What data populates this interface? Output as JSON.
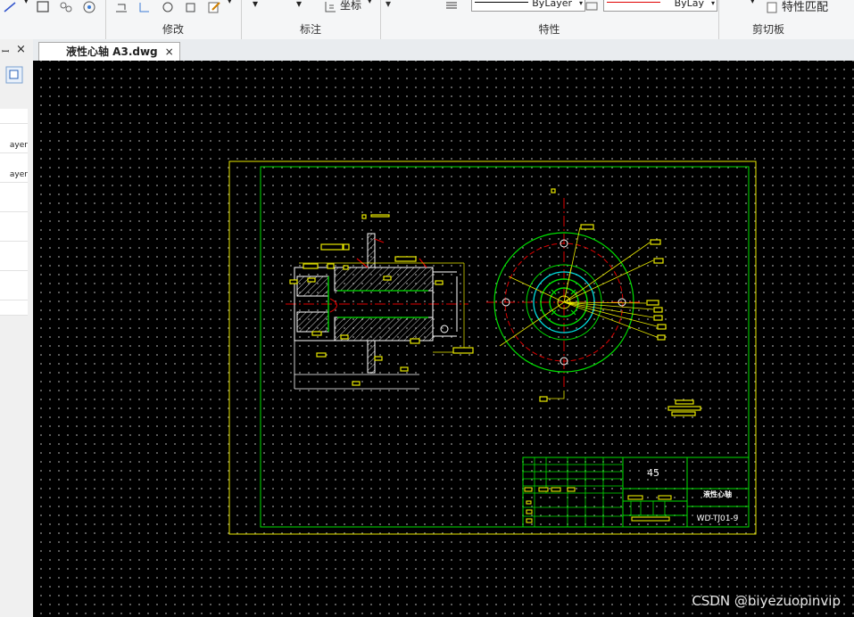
{
  "ribbon": {
    "modify_label": "修改",
    "annotate_label": "标注",
    "properties_label": "特性",
    "clipboard_label": "剪切板",
    "coordinate_label": "坐标",
    "color_combo": "ByLayer",
    "linetype_combo": "ByLay",
    "match_properties_label": "特性匹配",
    "colors": {
      "linetype_line": "#000000",
      "color_line": "#e00000"
    }
  },
  "side_panel": {
    "rows": [
      "",
      "",
      "ayer",
      "",
      "ayer",
      "",
      "",
      "",
      "",
      "",
      "",
      "",
      "",
      ""
    ]
  },
  "tabs": {
    "document_tab": "液性心轴 A3.dwg",
    "close_glyph": "×"
  },
  "drawing": {
    "title_block": {
      "material": "45",
      "part_name": "液性心轴",
      "drawing_number": "WD-TJ01-9"
    },
    "colors": {
      "border": "#e8e800",
      "frame": "#00e000",
      "center": "#e00000",
      "cyan": "#00e0e0",
      "text": "#ffffff"
    }
  },
  "watermark": "CSDN @biyezuopinvip"
}
